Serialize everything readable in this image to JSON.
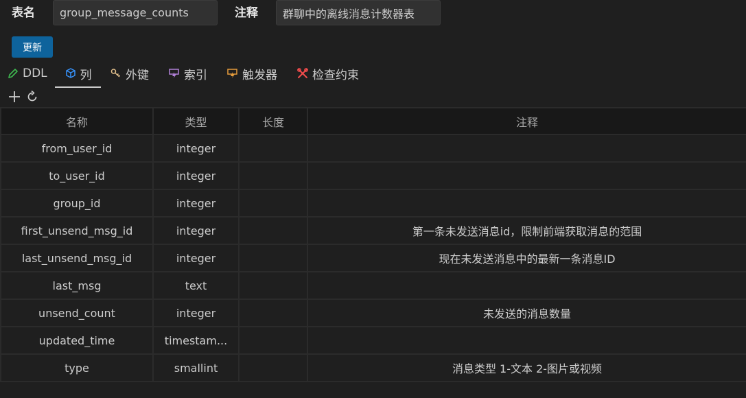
{
  "header": {
    "table_name_label": "表名",
    "table_name_value": "group_message_counts",
    "comment_label": "注释",
    "comment_value": "群聊中的离线消息计数器表",
    "update_label": "更新"
  },
  "tabs": [
    {
      "label": "DDL",
      "icon": "pencil-icon",
      "color": "#3fb950"
    },
    {
      "label": "列",
      "icon": "cube-icon",
      "color": "#3794ff",
      "active": true
    },
    {
      "label": "外键",
      "icon": "key-icon",
      "color": "#e2c08d"
    },
    {
      "label": "索引",
      "icon": "index-icon",
      "color": "#b180d7"
    },
    {
      "label": "触发器",
      "icon": "trigger-icon",
      "color": "#e59c3c"
    },
    {
      "label": "检查约束",
      "icon": "tools-icon",
      "color": "#f14c4c"
    }
  ],
  "toolbar": {
    "add_icon": "plus-icon",
    "refresh_icon": "refresh-icon"
  },
  "columns_table": {
    "headers": [
      "名称",
      "类型",
      "长度",
      "注释"
    ],
    "rows": [
      {
        "name": "from_user_id",
        "type": "integer",
        "length": "",
        "comment": ""
      },
      {
        "name": "to_user_id",
        "type": "integer",
        "length": "",
        "comment": ""
      },
      {
        "name": "group_id",
        "type": "integer",
        "length": "",
        "comment": ""
      },
      {
        "name": "first_unsend_msg_id",
        "type": "integer",
        "length": "",
        "comment": "第一条未发送消息id，限制前端获取消息的范围"
      },
      {
        "name": "last_unsend_msg_id",
        "type": "integer",
        "length": "",
        "comment": "现在未发送消息中的最新一条消息ID"
      },
      {
        "name": "last_msg",
        "type": "text",
        "length": "",
        "comment": ""
      },
      {
        "name": "unsend_count",
        "type": "integer",
        "length": "",
        "comment": "未发送的消息数量"
      },
      {
        "name": "updated_time",
        "type": "timestam...",
        "length": "",
        "comment": ""
      },
      {
        "name": "type",
        "type": "smallint",
        "length": "",
        "comment": "消息类型 1-文本 2-图片或视频"
      }
    ]
  },
  "colors": {
    "background": "#1f1f1f",
    "header_bg": "#181818",
    "accent_button": "#0e639c",
    "border": "#2b2b2b"
  }
}
